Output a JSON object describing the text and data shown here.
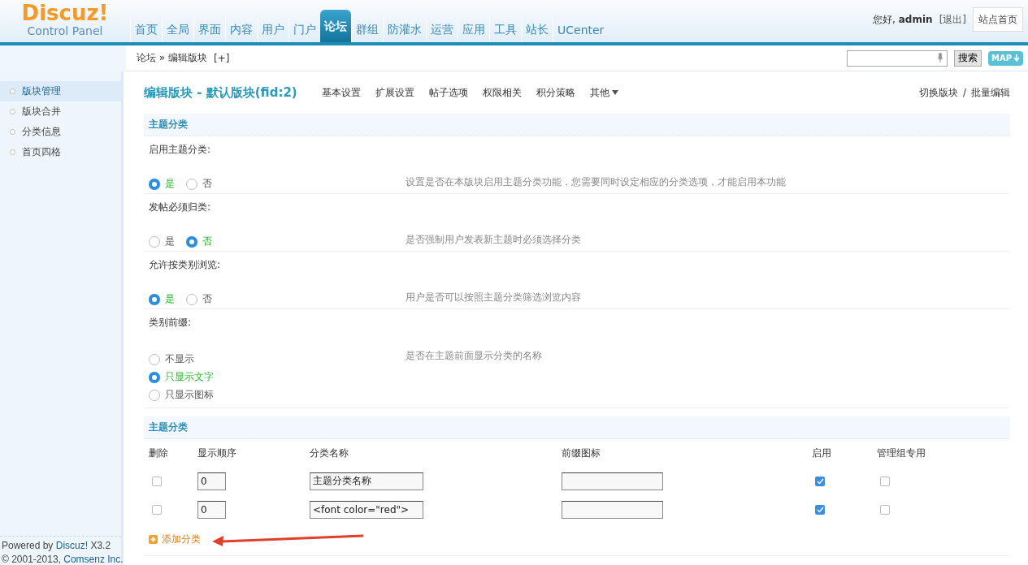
{
  "logo": {
    "name": "Discuz!",
    "subtitle": "Control Panel"
  },
  "nav": [
    {
      "label": "首页",
      "selected": false
    },
    {
      "label": "全局",
      "selected": false
    },
    {
      "label": "界面",
      "selected": false
    },
    {
      "label": "内容",
      "selected": false
    },
    {
      "label": "用户",
      "selected": false
    },
    {
      "label": "门户",
      "selected": false
    },
    {
      "label": "论坛",
      "selected": true
    },
    {
      "label": "群组",
      "selected": false
    },
    {
      "label": "防灌水",
      "selected": false
    },
    {
      "label": "运营",
      "selected": false
    },
    {
      "label": "应用",
      "selected": false
    },
    {
      "label": "工具",
      "selected": false
    },
    {
      "label": "站长",
      "selected": false
    },
    {
      "label": "UCenter",
      "selected": false
    }
  ],
  "user": {
    "greeting": "您好,",
    "name": "admin",
    "logout": "[退出]",
    "home": "站点首页"
  },
  "breadcrumb": {
    "path": "论坛 » 编辑版块",
    "add": "[+]"
  },
  "search": {
    "button": "搜索",
    "map": "MAP"
  },
  "sidebar": {
    "items": [
      {
        "label": "版块管理",
        "selected": true
      },
      {
        "label": "版块合并",
        "selected": false
      },
      {
        "label": "分类信息",
        "selected": false
      },
      {
        "label": "首页四格",
        "selected": false
      }
    ],
    "footer": [
      {
        "prefix": "Powered by",
        "link": "Discuz!",
        "suffix": "X3.2"
      },
      {
        "prefix": "© 2001-2013,",
        "link": "Comsenz Inc."
      }
    ]
  },
  "page": {
    "title": "编辑版块 - 默认版块(fid:2)",
    "tabs": [
      "基本设置",
      "扩展设置",
      "帖子选项",
      "权限相关",
      "积分策略"
    ],
    "more": "其他",
    "switch": "切换版块",
    "separator": "/",
    "batch": "批量编辑"
  },
  "settings": {
    "title": "主题分类",
    "items": [
      {
        "label": "启用主题分类:",
        "kind": "inline",
        "hint": "设置是否在本版块启用主题分类功能，您需要同时设定相应的分类选项，才能启用本功能",
        "options": [
          {
            "label": "是",
            "selected": true
          },
          {
            "label": "否",
            "selected": false
          }
        ]
      },
      {
        "label": "发帖必须归类:",
        "kind": "inline",
        "hint": "是否强制用户发表新主题时必须选择分类",
        "options": [
          {
            "label": "是",
            "selected": false
          },
          {
            "label": "否",
            "selected": true
          }
        ]
      },
      {
        "label": "允许按类别浏览:",
        "kind": "inline",
        "hint": "用户是否可以按照主题分类筛选浏览内容",
        "options": [
          {
            "label": "是",
            "selected": true
          },
          {
            "label": "否",
            "selected": false
          }
        ]
      },
      {
        "label": "类别前缀:",
        "kind": "stacked",
        "hint": "是否在主题前面显示分类的名称",
        "options": [
          {
            "label": "不显示",
            "selected": false
          },
          {
            "label": "只显示文字",
            "selected": true
          },
          {
            "label": "只显示图标",
            "selected": false
          }
        ]
      }
    ]
  },
  "category_table": {
    "title": "主题分类",
    "columns": [
      "删除",
      "显示顺序",
      "分类名称",
      "前缀图标",
      "启用",
      "管理组专用"
    ],
    "rows": [
      {
        "delete": false,
        "order": "0",
        "name": "主题分类名称",
        "enabled": true,
        "admin_only": false
      },
      {
        "delete": false,
        "order": "0",
        "name": "<font color=\"red\">",
        "enabled": true,
        "admin_only": false
      }
    ],
    "add": "添加分类"
  }
}
